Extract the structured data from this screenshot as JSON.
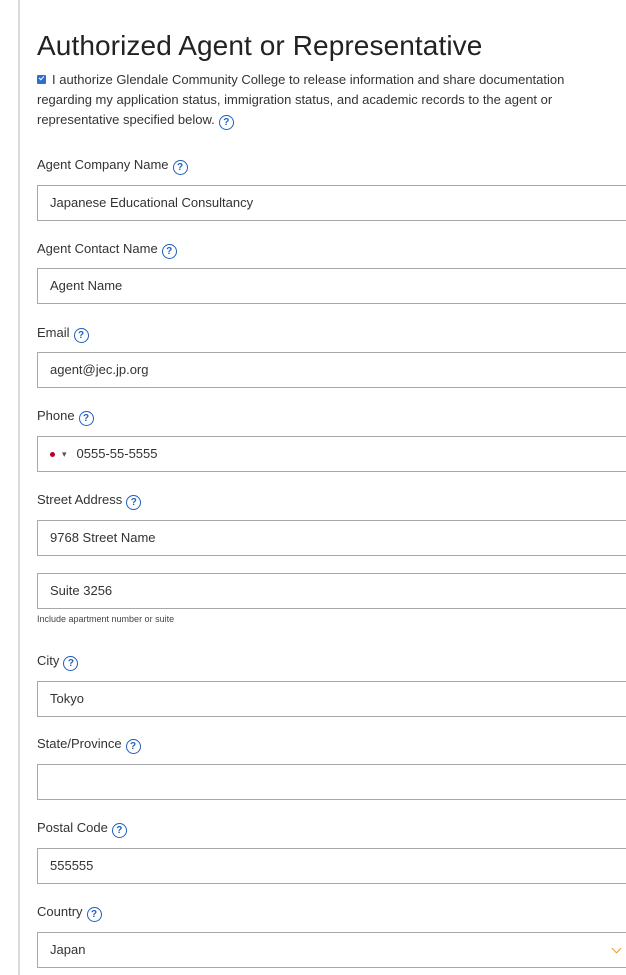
{
  "section": {
    "title": "Authorized Agent or Representative",
    "consent_text": "I authorize Glendale Community College to release information and share documentation regarding my application status, immigration status, and academic records to the agent or representative specified below.",
    "consent_checked": true
  },
  "fields": {
    "agent_company": {
      "label": "Agent Company Name",
      "value": "Japanese Educational Consultancy"
    },
    "agent_contact": {
      "label": "Agent Contact Name",
      "value": "Agent Name"
    },
    "email": {
      "label": "Email",
      "value": "agent@jec.jp.org"
    },
    "phone": {
      "label": "Phone",
      "value": "0555-55-5555",
      "flag_color": "#bc002d"
    },
    "street": {
      "label": "Street Address",
      "line1": "9768 Street Name",
      "line2": "Suite 3256",
      "hint": "Include apartment number or suite"
    },
    "city": {
      "label": "City",
      "value": "Tokyo"
    },
    "state": {
      "label": "State/Province",
      "value": ""
    },
    "postal": {
      "label": "Postal Code",
      "value": "555555"
    },
    "country": {
      "label": "Country",
      "value": "Japan"
    }
  },
  "icons": {
    "help": "question-circle-icon",
    "help_glyph": "?",
    "checkbox": "checkbox-checked-icon",
    "dropdown": "chevron-down-icon",
    "flag": "japan-flag-icon"
  },
  "colors": {
    "accent": "#1f5fbf",
    "checkbox": "#2e6fd1",
    "border": "#a8a8a8",
    "chevron": "#e0a030"
  }
}
